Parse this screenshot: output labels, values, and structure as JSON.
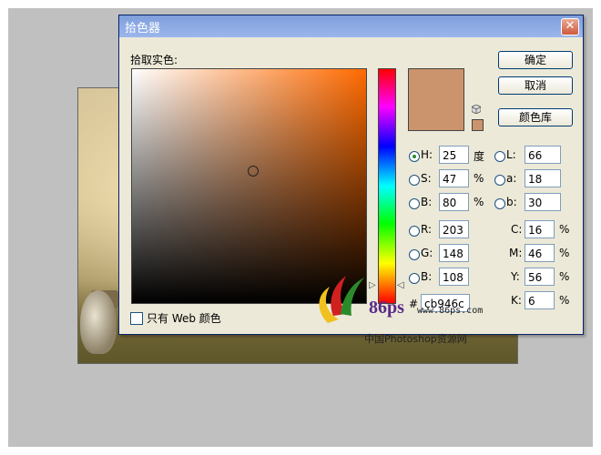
{
  "window": {
    "title": "拾色器",
    "close_glyph": "✕"
  },
  "picker": {
    "label": "拾取实色:",
    "web_only_label": "只有 Web 颜色",
    "swatch_color": "#cb946c"
  },
  "buttons": {
    "ok": "确定",
    "cancel": "取消",
    "library": "颜色库"
  },
  "hsb": {
    "h": {
      "label": "H:",
      "value": "25",
      "unit": "度"
    },
    "s": {
      "label": "S:",
      "value": "47",
      "unit": "%"
    },
    "b": {
      "label": "B:",
      "value": "80",
      "unit": "%"
    }
  },
  "rgb": {
    "r": {
      "label": "R:",
      "value": "203"
    },
    "g": {
      "label": "G:",
      "value": "148"
    },
    "b": {
      "label": "B:",
      "value": "108"
    }
  },
  "lab": {
    "l": {
      "label": "L:",
      "value": "66"
    },
    "a": {
      "label": "a:",
      "value": "18"
    },
    "b": {
      "label": "b:",
      "value": "30"
    }
  },
  "cmyk": {
    "c": {
      "label": "C:",
      "value": "16",
      "unit": "%"
    },
    "m": {
      "label": "M:",
      "value": "46",
      "unit": "%"
    },
    "y": {
      "label": "Y:",
      "value": "56",
      "unit": "%"
    },
    "k": {
      "label": "K:",
      "value": "6",
      "unit": "%"
    }
  },
  "hex": {
    "label": "#",
    "value": "cb946c"
  },
  "watermark": {
    "brand": "86ps",
    "url": "www.86ps.com",
    "cn": "中国Photoshop资源网"
  }
}
